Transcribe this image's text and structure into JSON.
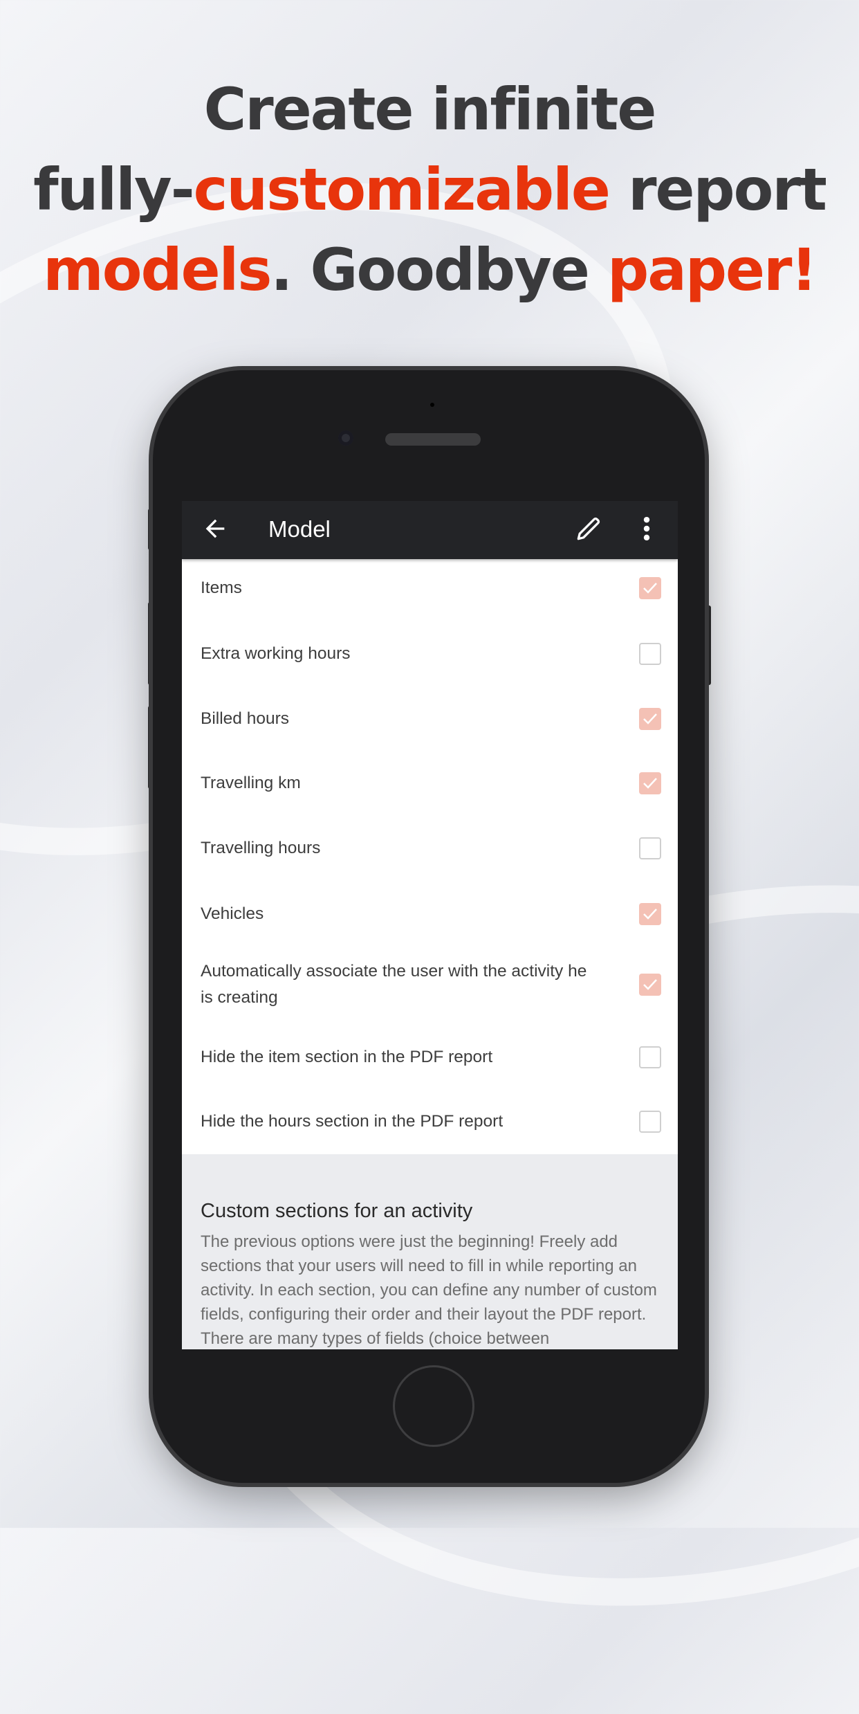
{
  "headline": {
    "line1": "Create infinite",
    "line2_a": "fully-",
    "line2_b": "customizable",
    "line2_c": " report",
    "line3_a": "models",
    "line3_b": ". Goodbye ",
    "line3_c": "paper!",
    "accent_color": "#e8340c",
    "text_color": "#3a3a3c"
  },
  "toolbar": {
    "title": "Model",
    "back_icon": "arrow-left-icon",
    "edit_icon": "pencil-icon",
    "more_icon": "more-vertical-icon"
  },
  "options": [
    {
      "label": "Items",
      "checked": true
    },
    {
      "label": "Extra working hours",
      "checked": false
    },
    {
      "label": "Billed hours",
      "checked": true
    },
    {
      "label": "Travelling km",
      "checked": true
    },
    {
      "label": "Travelling hours",
      "checked": false
    },
    {
      "label": "Vehicles",
      "checked": true
    },
    {
      "label": "Automatically associate the user with the activity he is creating",
      "checked": true
    },
    {
      "label": "Hide the item section in the PDF report",
      "checked": false
    },
    {
      "label": "Hide the hours section in the PDF report",
      "checked": false
    }
  ],
  "custom_section": {
    "title": "Custom sections for an activity",
    "body": "The previous options were just the beginning! Freely add sections that your users will need to fill in while reporting an activity. In each section, you can define any number of custom fields, configuring their order and their layout the PDF report. There are many types of fields (choice between"
  }
}
